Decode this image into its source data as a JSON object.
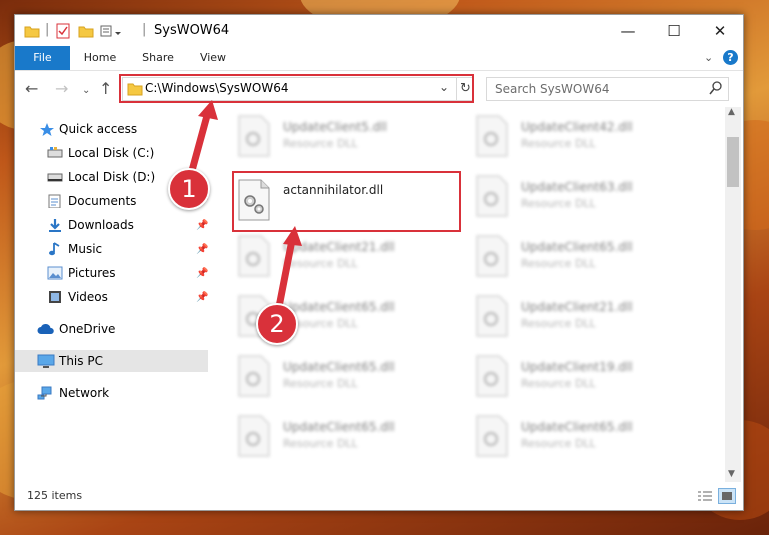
{
  "window": {
    "title": "SysWOW64",
    "controls": {
      "minimize": "—",
      "maximize": "☐",
      "close": "✕"
    }
  },
  "ribbon": {
    "tabs": [
      {
        "label": "File"
      },
      {
        "label": "Home"
      },
      {
        "label": "Share"
      },
      {
        "label": "View"
      }
    ],
    "help_label": "?"
  },
  "address": {
    "path": "C:\\Windows\\SysWOW64",
    "search_placeholder": "Search SysWOW64"
  },
  "sidebar": {
    "items": [
      {
        "label": "Quick access",
        "icon": "star-icon",
        "pinned": false
      },
      {
        "label": "Local Disk (C:)",
        "icon": "drive-icon",
        "pinned": false
      },
      {
        "label": "Local Disk (D:)",
        "icon": "drive-icon",
        "pinned": false
      },
      {
        "label": "Documents",
        "icon": "documents-icon",
        "pinned": true
      },
      {
        "label": "Downloads",
        "icon": "downloads-icon",
        "pinned": true
      },
      {
        "label": "Music",
        "icon": "music-icon",
        "pinned": true
      },
      {
        "label": "Pictures",
        "icon": "pictures-icon",
        "pinned": true
      },
      {
        "label": "Videos",
        "icon": "videos-icon",
        "pinned": true
      },
      {
        "label": "OneDrive",
        "icon": "cloud-icon",
        "pinned": false
      },
      {
        "label": "This PC",
        "icon": "computer-icon",
        "pinned": false
      },
      {
        "label": "Network",
        "icon": "network-icon",
        "pinned": false
      }
    ],
    "selected": "This PC"
  },
  "files": {
    "highlighted": {
      "name": "actannihilator.dll"
    },
    "left_column": [
      {
        "name": "UpdateClient5.dll",
        "type": "Resource DLL"
      },
      {
        "name": "UpdateClient21.dll",
        "type": "Resource DLL"
      },
      {
        "name": "UpdateClient65.dll",
        "type": "Resource DLL"
      },
      {
        "name": "UpdateClient65.dll",
        "type": "Resource DLL"
      },
      {
        "name": "UpdateClient65.dll",
        "type": "Resource DLL"
      }
    ],
    "right_column": [
      {
        "name": "UpdateClient42.dll",
        "type": "Resource DLL"
      },
      {
        "name": "UpdateClient63.dll",
        "type": "Resource DLL"
      },
      {
        "name": "UpdateClient65.dll",
        "type": "Resource DLL"
      },
      {
        "name": "UpdateClient21.dll",
        "type": "Resource DLL"
      },
      {
        "name": "UpdateClient19.dll",
        "type": "Resource DLL"
      },
      {
        "name": "UpdateClient65.dll",
        "type": "Resource DLL"
      }
    ]
  },
  "status": {
    "item_count": "125 items"
  },
  "markers": [
    {
      "label": "1"
    },
    {
      "label": "2"
    }
  ],
  "colors": {
    "accent": "#1979ca",
    "highlight": "#d9313a",
    "selected_bg": "#e5e5e5"
  }
}
